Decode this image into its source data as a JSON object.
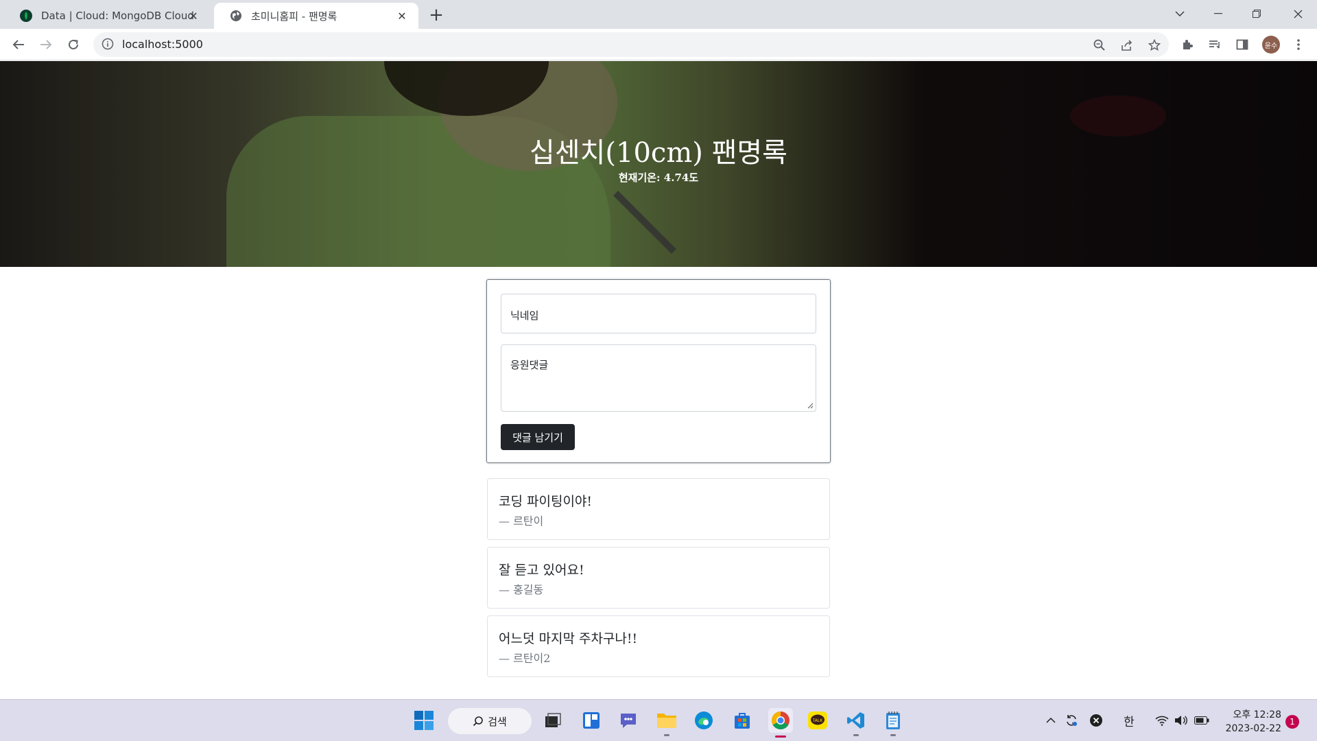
{
  "browser": {
    "tabs": [
      {
        "title": "Data | Cloud: MongoDB Cloud",
        "icon": "mongodb-leaf-icon",
        "active": false
      },
      {
        "title": "초미니홈피 - 팬명록",
        "icon": "globe-icon",
        "active": true
      }
    ],
    "address": "localhost:5000",
    "profile_initials": "윤수"
  },
  "page": {
    "title": "십센치(10cm) 팬명록",
    "weather": "현재기온: 4.74도",
    "form": {
      "name_placeholder": "닉네임",
      "comment_placeholder": "응원댓글",
      "submit_label": "댓글 남기기"
    },
    "comments": [
      {
        "text": "코딩 파이팅이야!",
        "author": "— 르탄이"
      },
      {
        "text": "잘 듣고 있어요!",
        "author": "— 홍길동"
      },
      {
        "text": "어느덧 마지막 주차구나!!",
        "author": "— 르탄이2"
      }
    ]
  },
  "taskbar": {
    "search_label": "검색",
    "ime": "한",
    "time": "오후 12:28",
    "date": "2023-02-22",
    "notifications": "1"
  },
  "colors": {
    "tabbar": "#dee1e6",
    "button_dark": "#212529",
    "muted_text": "#6c757d",
    "taskbar": "#dcdcec"
  }
}
